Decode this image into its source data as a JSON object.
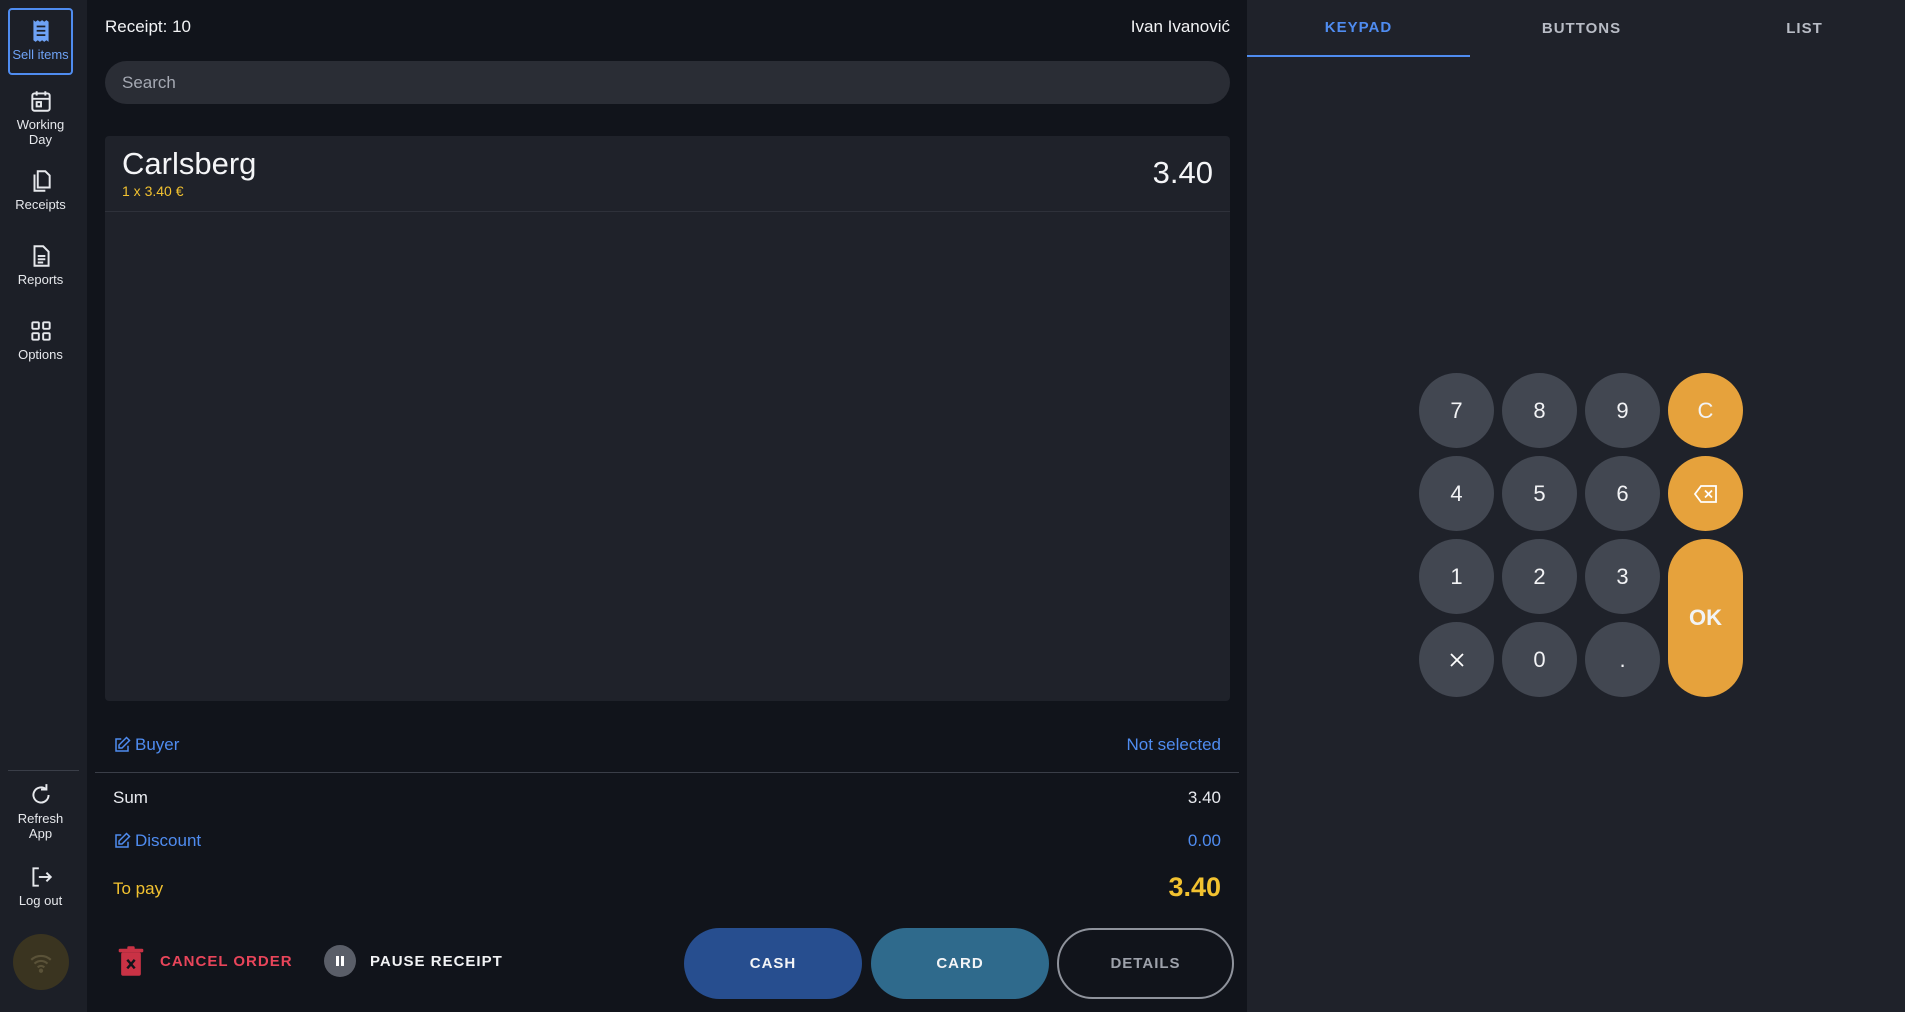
{
  "sidebar": {
    "items": [
      {
        "label": "Sell items",
        "icon": "receipt-icon"
      },
      {
        "label": "Working\nDay",
        "icon": "calendar-icon"
      },
      {
        "label": "Receipts",
        "icon": "documents-icon"
      },
      {
        "label": "Reports",
        "icon": "report-icon"
      },
      {
        "label": "Options",
        "icon": "grid-icon"
      }
    ],
    "bottom_items": [
      {
        "label": "Refresh\nApp",
        "icon": "refresh-icon"
      },
      {
        "label": "Log out",
        "icon": "logout-icon"
      }
    ],
    "status_icon": "wifi-icon"
  },
  "header": {
    "receipt_label": "Receipt: 10",
    "user_name": "Ivan Ivanović"
  },
  "search": {
    "placeholder": "Search",
    "value": ""
  },
  "items": [
    {
      "name": "Carlsberg",
      "qty_line": "1 x 3.40 €",
      "total": "3.40"
    }
  ],
  "summary": {
    "buyer_label": "Buyer",
    "buyer_value": "Not selected",
    "sum_label": "Sum",
    "sum_value": "3.40",
    "discount_label": "Discount",
    "discount_value": "0.00",
    "topay_label": "To pay",
    "topay_value": "3.40"
  },
  "actions": {
    "cancel_label": "CANCEL ORDER",
    "pause_label": "PAUSE RECEIPT",
    "cash_label": "CASH",
    "card_label": "CARD",
    "details_label": "DETAILS"
  },
  "tabs": [
    {
      "label": "KEYPAD",
      "active": true
    },
    {
      "label": "BUTTONS",
      "active": false
    },
    {
      "label": "LIST",
      "active": false
    }
  ],
  "keypad": {
    "k7": "7",
    "k8": "8",
    "k9": "9",
    "clear": "C",
    "k4": "4",
    "k5": "5",
    "k6": "6",
    "k1": "1",
    "k2": "2",
    "k3": "3",
    "k0": "0",
    "dot": ".",
    "ok": "OK"
  },
  "colors": {
    "accent": "#4f8cf0",
    "warning": "#f2c230",
    "keypad_orange": "#e6a23c",
    "cancel": "#e8455a"
  }
}
